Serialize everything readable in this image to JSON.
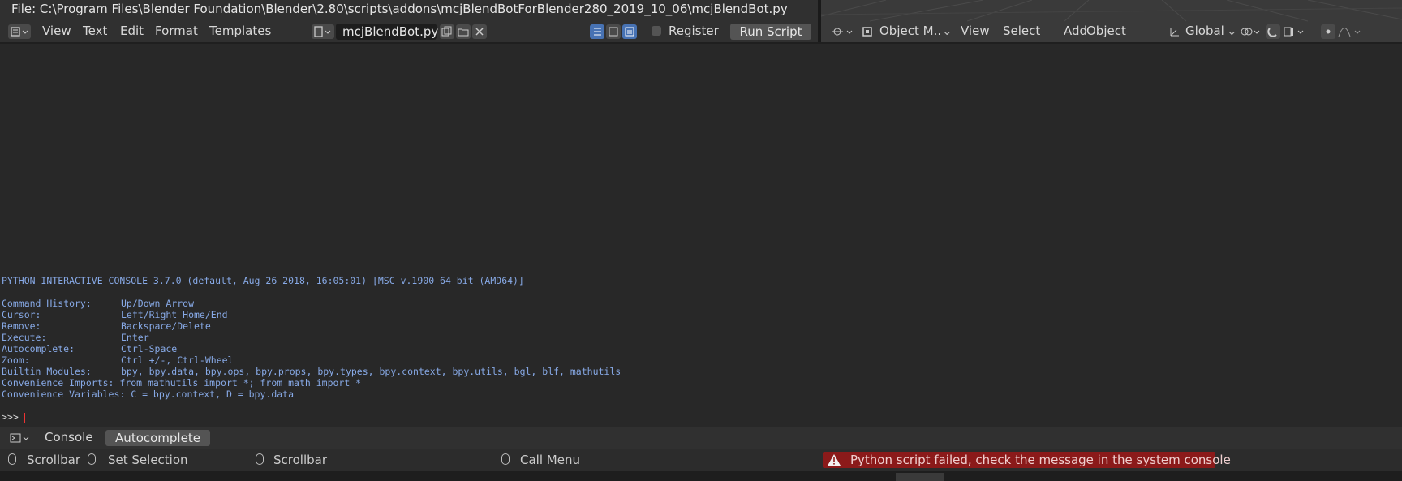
{
  "file_title": "File: C:\\Program Files\\Blender Foundation\\Blender\\2.80\\scripts\\addons\\mcjBlendBotForBlender280_2019_10_06\\mcjBlendBot.py",
  "text_editor": {
    "menus": [
      "View",
      "Text",
      "Edit",
      "Format",
      "Templates"
    ],
    "filename": "mcjBlendBot.py",
    "register_label": "Register",
    "register_checked": false,
    "run_script_label": "Run Script"
  },
  "viewport": {
    "mode_label": "Object M..",
    "menus": [
      "View",
      "Select",
      "Add",
      "Object"
    ],
    "orientation": "Global"
  },
  "console": {
    "banner": "PYTHON INTERACTIVE CONSOLE 3.7.0 (default, Aug 26 2018, 16:05:01) [MSC v.1900 64 bit (AMD64)]",
    "help": [
      {
        "key": "Command History:",
        "value": "Up/Down Arrow"
      },
      {
        "key": "Cursor:",
        "value": "Left/Right Home/End"
      },
      {
        "key": "Remove:",
        "value": "Backspace/Delete"
      },
      {
        "key": "Execute:",
        "value": "Enter"
      },
      {
        "key": "Autocomplete:",
        "value": "Ctrl-Space"
      },
      {
        "key": "Zoom:",
        "value": "Ctrl +/-, Ctrl-Wheel"
      },
      {
        "key": "Builtin Modules:",
        "value": "bpy, bpy.data, bpy.ops, bpy.props, bpy.types, bpy.context, bpy.utils, bgl, blf, mathutils"
      }
    ],
    "imports": "Convenience Imports: from mathutils import *; from math import *",
    "variables": "Convenience Variables: C = bpy.context, D = bpy.data",
    "prompt": ">>>"
  },
  "console_header": {
    "tabs": [
      "Console",
      "Autocomplete"
    ]
  },
  "statusbar": {
    "left_mouse": "Scrollbar",
    "middle_mouse": "Set Selection",
    "right_mouse": "Scrollbar",
    "call_menu": "Call Menu",
    "error": "Python script failed, check the message in the system console"
  },
  "colors": {
    "console_text": "#87a9e6",
    "error_bg": "#8b1a1a",
    "accent_blue": "#4772b3"
  }
}
